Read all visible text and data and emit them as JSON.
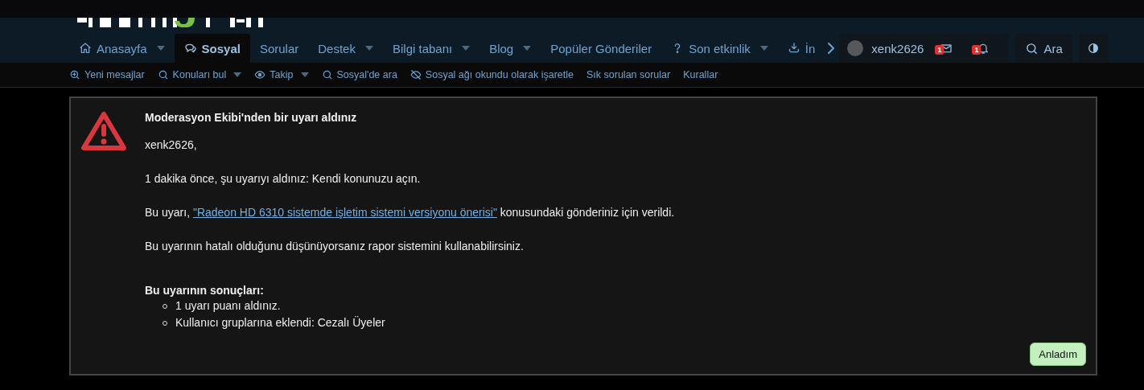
{
  "nav": {
    "tabs": [
      {
        "label": "Anasayfa",
        "kind": "home",
        "dropdown": true,
        "selected": false
      },
      {
        "label": "Sosyal",
        "kind": "chat",
        "dropdown": false,
        "selected": true
      },
      {
        "label": "Sorular",
        "kind": "plain",
        "dropdown": false,
        "selected": false
      },
      {
        "label": "Destek",
        "kind": "plain",
        "dropdown": true,
        "selected": false
      },
      {
        "label": "Bilgi tabanı",
        "kind": "plain",
        "dropdown": true,
        "selected": false
      },
      {
        "label": "Blog",
        "kind": "plain",
        "dropdown": true,
        "selected": false
      },
      {
        "label": "Popüler Gönderiler",
        "kind": "plain",
        "dropdown": false,
        "selected": false
      },
      {
        "label": "Son etkinlik",
        "kind": "help",
        "dropdown": true,
        "selected": false
      },
      {
        "label": "İn",
        "kind": "download",
        "dropdown": false,
        "selected": false
      }
    ],
    "account": {
      "username": "xenk2626",
      "messages_badge": "1",
      "alerts_badge": "1"
    },
    "search": {
      "label": "Ara"
    }
  },
  "subnav": [
    {
      "label": "Yeni mesajlar",
      "kind": "new",
      "dropdown": false
    },
    {
      "label": "Konuları bul",
      "kind": "search",
      "dropdown": true
    },
    {
      "label": "Takip",
      "kind": "eye",
      "dropdown": true
    },
    {
      "label": "Sosyal'de ara",
      "kind": "search",
      "dropdown": false
    },
    {
      "label": "Sosyal ağı okundu olarak işaretle",
      "kind": "eye-off",
      "dropdown": false
    },
    {
      "label": "Sık sorulan sorular",
      "kind": "plain",
      "dropdown": false
    },
    {
      "label": "Kurallar",
      "kind": "plain",
      "dropdown": false
    }
  ],
  "warning": {
    "title": "Moderasyon Ekibi'nden bir uyarı aldınız",
    "greeting": "xenk2626,",
    "received": "1 dakika önce, şu uyarıyı aldınız: Kendi konunuzu açın.",
    "reason": {
      "before": "Bu uyarı, ",
      "link": "\"Radeon HD 6310 sistemde işletim sistemi versiyonu önerisi\"",
      "after": " konusundaki gönderiniz için verildi."
    },
    "report": "Bu uyarının hatalı olduğunu düşünüyorsanız rapor sistemini kullanabilirsiniz.",
    "consequences_title": "Bu uyarının sonuçları:",
    "consequences": [
      "1 uyarı puanı aldınız.",
      "Kullanıcı gruplarına eklendi: Cezalı Üyeler"
    ],
    "button": "Anladım"
  }
}
